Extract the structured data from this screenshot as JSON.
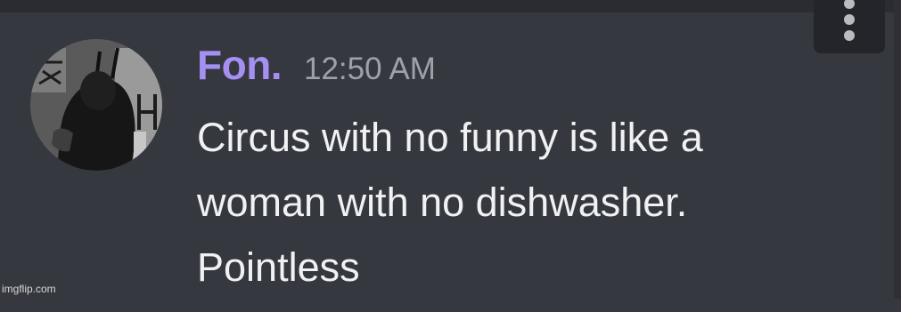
{
  "message": {
    "author": "Fon.",
    "timestamp": "12:50 AM",
    "lines": [
      "Circus with no funny is like a",
      "woman with no dishwasher.",
      "Pointless"
    ],
    "author_color": "#a68ff3"
  },
  "actions": {
    "more_icon": "more-vertical-icon"
  },
  "watermark": "imgflip.com"
}
